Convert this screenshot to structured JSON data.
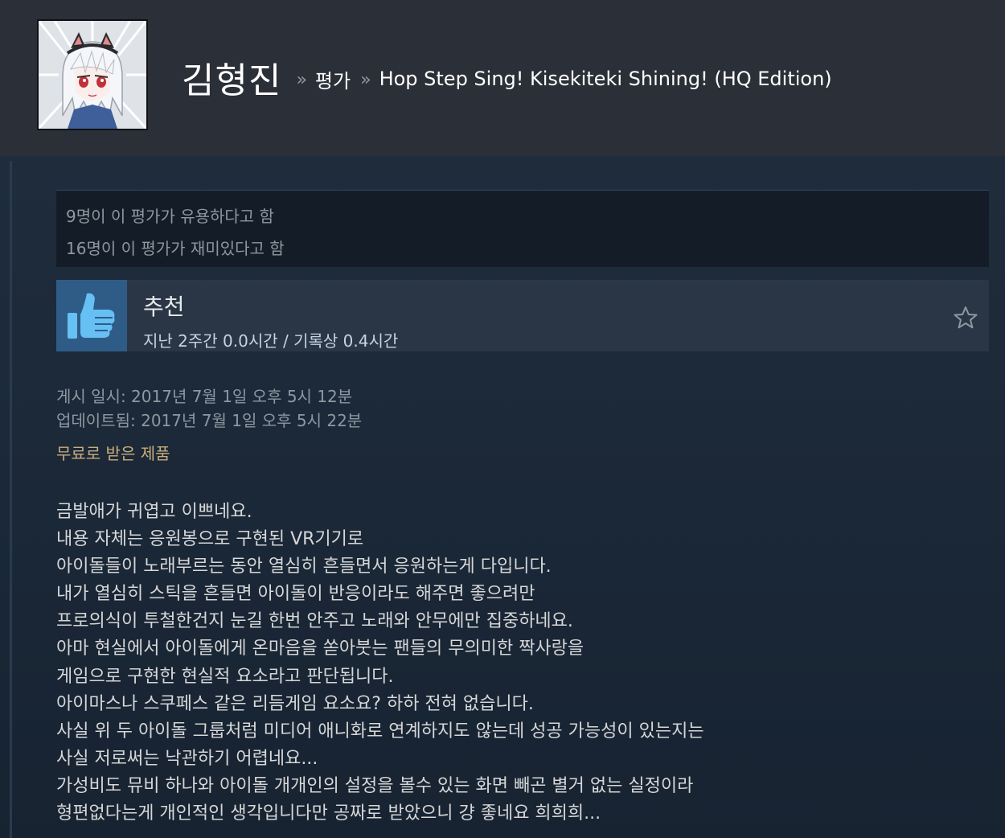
{
  "header": {
    "user_name": "김형진",
    "separator": "»",
    "section": "평가",
    "game_title": "Hop Step Sing! Kisekiteki Shining! (HQ Edition)",
    "avatar_icon": "anime-avatar-icon"
  },
  "votes": {
    "helpful": "9명이 이 평가가 유용하다고 함",
    "funny": "16명이 이 평가가 재미있다고 함"
  },
  "recommendation": {
    "thumb_icon": "thumbs-up-icon",
    "title": "추천",
    "hours": "지난 2주간 0.0시간 / 기록상 0.4시간",
    "star_icon": "star-outline-icon"
  },
  "meta": {
    "posted": "게시 일시: 2017년 7월 1일 오후 5시 12분",
    "updated": "업데이트됨: 2017년 7월 1일 오후 5시 22분",
    "received_free": "무료로 받은 제품"
  },
  "review": {
    "lines": [
      "금발애가 귀엽고 이쁘네요.",
      "내용 자체는 응원봉으로 구현된 VR기기로",
      "아이돌들이 노래부르는 동안 열심히 흔들면서 응원하는게 다입니다.",
      "내가 열심히 스틱을 흔들면 아이돌이 반응이라도 해주면 좋으려만",
      "프로의식이 투철한건지 눈길 한번 안주고 노래와 안무에만 집중하네요.",
      "아마 현실에서 아이돌에게 온마음을 쏟아붓는 팬들의 무의미한 짝사랑을",
      "게임으로 구현한 현실적 요소라고 판단됩니다.",
      "아이마스나 스쿠페스 같은 리듬게임 요소요? 하하 전혀 없습니다.",
      "사실 위 두 아이돌 그룹처럼 미디어 애니화로 연계하지도 않는데 성공 가능성이 있는지는",
      "사실 저로써는 낙관하기 어렵네요...",
      "가성비도 뮤비 하나와 아이돌 개개인의 설정을 볼수 있는 화면 빼곤 별거 없는 실정이라",
      "형편없다는게 개인적인 생각입니다만 공짜로 받았으니 걍 좋네요 희희희..."
    ]
  },
  "colors": {
    "page_bg": "#1b2838",
    "header_bg": "#2b2f38",
    "thumb_bg": "#2f5c86",
    "muted_text": "#8f98a0",
    "free_tag": "#c9ad7b"
  }
}
